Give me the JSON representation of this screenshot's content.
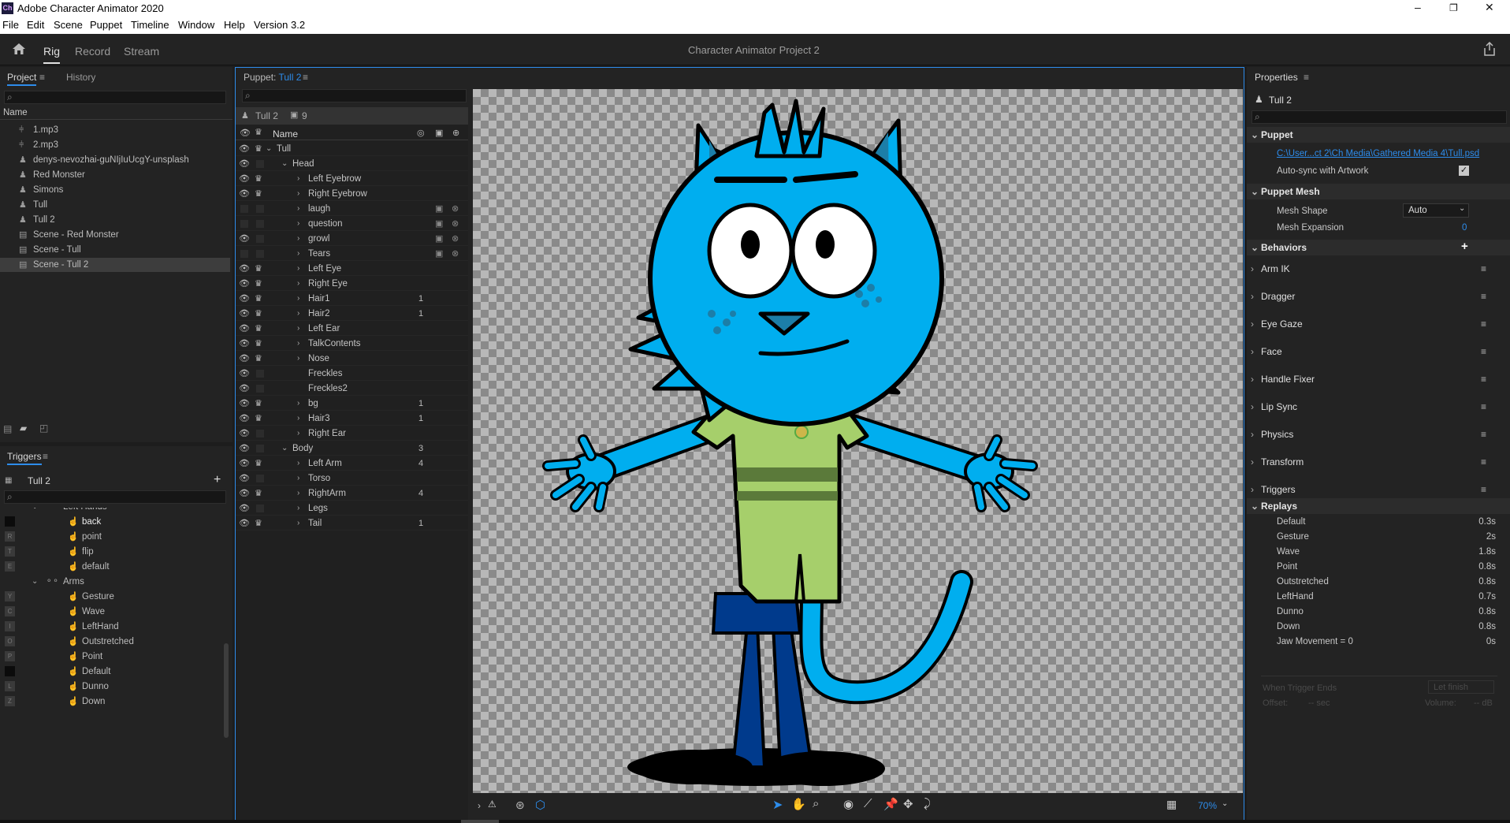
{
  "window": {
    "app_badge": "Ch",
    "title": "Adobe Character Animator 2020",
    "minimize": "–",
    "maximize": "❐",
    "close": "✕"
  },
  "menu": [
    "File",
    "Edit",
    "Scene",
    "Puppet",
    "Timeline",
    "Window",
    "Help",
    "Version 3.2"
  ],
  "header": {
    "tabs": [
      "Rig",
      "Record",
      "Stream"
    ],
    "active_tab": "Rig",
    "project_title": "Character Animator Project 2"
  },
  "project_panel": {
    "tabs": [
      "Project",
      "History"
    ],
    "column_header": "Name",
    "items": [
      {
        "name": "1.mp3",
        "icon": "audio-icon"
      },
      {
        "name": "2.mp3",
        "icon": "audio-icon"
      },
      {
        "name": "denys-nevozhai-guNIjIuUcgY-unsplash",
        "icon": "puppet-icon"
      },
      {
        "name": "Red Monster",
        "icon": "puppet-icon"
      },
      {
        "name": "Simons",
        "icon": "puppet-icon"
      },
      {
        "name": "Tull",
        "icon": "puppet-icon"
      },
      {
        "name": "Tull 2",
        "icon": "puppet-icon"
      },
      {
        "name": "Scene - Red Monster",
        "icon": "scene-icon"
      },
      {
        "name": "Scene - Tull",
        "icon": "scene-icon"
      },
      {
        "name": "Scene - Tull 2",
        "icon": "scene-icon",
        "selected": true
      }
    ]
  },
  "triggers_panel": {
    "title": "Triggers",
    "puppet_name": "Tull 2",
    "add": "+",
    "rows": [
      {
        "label": "Left Hands",
        "kind": "group",
        "key": ""
      },
      {
        "label": "back",
        "kind": "trigger",
        "key": "",
        "keycolor": "black",
        "bright": true
      },
      {
        "label": "point",
        "kind": "trigger",
        "key": "R"
      },
      {
        "label": "flip",
        "kind": "trigger",
        "key": "T"
      },
      {
        "label": "default",
        "kind": "trigger",
        "key": "E"
      },
      {
        "label": "Arms",
        "kind": "group",
        "key": ""
      },
      {
        "label": "Gesture",
        "kind": "trigger",
        "key": "Y"
      },
      {
        "label": "Wave",
        "kind": "trigger",
        "key": "C"
      },
      {
        "label": "LeftHand",
        "kind": "trigger",
        "key": "I"
      },
      {
        "label": "Outstretched",
        "kind": "trigger",
        "key": "O"
      },
      {
        "label": "Point",
        "kind": "trigger",
        "key": "P"
      },
      {
        "label": "Default",
        "kind": "trigger",
        "key": "",
        "keycolor": "black"
      },
      {
        "label": "Dunno",
        "kind": "trigger",
        "key": "L"
      },
      {
        "label": "Down",
        "kind": "trigger",
        "key": "Z"
      }
    ]
  },
  "puppet_panel": {
    "label_prefix": "Puppet:",
    "puppet_name": "Tull 2",
    "crumb": "Tull 2",
    "count": "9",
    "column_name": "Name",
    "layers": [
      {
        "name": "Tull",
        "depth": 0,
        "twisty": "open",
        "eye": true,
        "crown": true,
        "n": ""
      },
      {
        "name": "Head",
        "depth": 1,
        "twisty": "open",
        "eye": true,
        "crown": false,
        "n": ""
      },
      {
        "name": "Left Eyebrow",
        "depth": 2,
        "twisty": "closed",
        "eye": true,
        "crown": true,
        "n": ""
      },
      {
        "name": "Right Eyebrow",
        "depth": 2,
        "twisty": "closed",
        "eye": true,
        "crown": true,
        "n": ""
      },
      {
        "name": "laugh",
        "depth": 2,
        "twisty": "closed",
        "eye": false,
        "crown": false,
        "n": "",
        "trig": true
      },
      {
        "name": "question",
        "depth": 2,
        "twisty": "closed",
        "eye": false,
        "crown": false,
        "n": "",
        "trig": true
      },
      {
        "name": "growl",
        "depth": 2,
        "twisty": "closed",
        "eye": true,
        "crown": false,
        "n": "",
        "trig": true
      },
      {
        "name": "Tears",
        "depth": 2,
        "twisty": "closed",
        "eye": false,
        "crown": false,
        "n": "",
        "trig": true
      },
      {
        "name": "Left Eye",
        "depth": 2,
        "twisty": "closed",
        "eye": true,
        "crown": true,
        "n": ""
      },
      {
        "name": "Right Eye",
        "depth": 2,
        "twisty": "closed",
        "eye": true,
        "crown": true,
        "n": ""
      },
      {
        "name": "Hair1",
        "depth": 2,
        "twisty": "closed",
        "eye": true,
        "crown": true,
        "n": "1"
      },
      {
        "name": "Hair2",
        "depth": 2,
        "twisty": "closed",
        "eye": true,
        "crown": true,
        "n": "1"
      },
      {
        "name": "Left Ear",
        "depth": 2,
        "twisty": "closed",
        "eye": true,
        "crown": true,
        "n": ""
      },
      {
        "name": "TalkContents",
        "depth": 2,
        "twisty": "closed",
        "eye": true,
        "crown": true,
        "n": ""
      },
      {
        "name": "Nose",
        "depth": 2,
        "twisty": "closed",
        "eye": true,
        "crown": true,
        "n": ""
      },
      {
        "name": "Freckles",
        "depth": 2,
        "twisty": "none",
        "eye": true,
        "crown": false,
        "n": ""
      },
      {
        "name": "Freckles2",
        "depth": 2,
        "twisty": "none",
        "eye": true,
        "crown": false,
        "n": ""
      },
      {
        "name": "bg",
        "depth": 2,
        "twisty": "closed",
        "eye": true,
        "crown": true,
        "n": "1"
      },
      {
        "name": "Hair3",
        "depth": 2,
        "twisty": "closed",
        "eye": true,
        "crown": true,
        "n": "1"
      },
      {
        "name": "Right Ear",
        "depth": 2,
        "twisty": "closed",
        "eye": true,
        "crown": false,
        "n": ""
      },
      {
        "name": "Body",
        "depth": 1,
        "twisty": "open",
        "eye": true,
        "crown": false,
        "n": "3"
      },
      {
        "name": "Left Arm",
        "depth": 2,
        "twisty": "closed",
        "eye": true,
        "crown": true,
        "n": "4"
      },
      {
        "name": "Torso",
        "depth": 2,
        "twisty": "closed",
        "eye": true,
        "crown": false,
        "n": ""
      },
      {
        "name": "RightArm",
        "depth": 2,
        "twisty": "closed",
        "eye": true,
        "crown": true,
        "n": "4"
      },
      {
        "name": "Legs",
        "depth": 2,
        "twisty": "closed",
        "eye": true,
        "crown": false,
        "n": ""
      },
      {
        "name": "Tail",
        "depth": 2,
        "twisty": "closed",
        "eye": true,
        "crown": true,
        "n": "1"
      }
    ],
    "zoom": "70%"
  },
  "properties": {
    "title": "Properties",
    "puppet_name": "Tull 2",
    "puppet_section": "Puppet",
    "file_path": "C:\\User...ct 2\\Ch Media\\Gathered Media 4\\Tull.psd",
    "autosync_label": "Auto-sync with Artwork",
    "mesh_section": "Puppet Mesh",
    "mesh_shape_label": "Mesh Shape",
    "mesh_shape_value": "Auto",
    "mesh_expansion_label": "Mesh Expansion",
    "mesh_expansion_value": "0",
    "behaviors_section": "Behaviors",
    "behaviors": [
      "Arm IK",
      "Dragger",
      "Eye Gaze",
      "Face",
      "Handle Fixer",
      "Lip Sync",
      "Physics",
      "Transform",
      "Triggers"
    ],
    "replays_section": "Replays",
    "replays": [
      {
        "name": "Default",
        "dur": "0.3s"
      },
      {
        "name": "Gesture",
        "dur": "2s"
      },
      {
        "name": "Wave",
        "dur": "1.8s"
      },
      {
        "name": "Point",
        "dur": "0.8s"
      },
      {
        "name": "Outstretched",
        "dur": "0.8s"
      },
      {
        "name": "LeftHand",
        "dur": "0.7s"
      },
      {
        "name": "Dunno",
        "dur": "0.8s"
      },
      {
        "name": "Down",
        "dur": "0.8s"
      },
      {
        "name": "Jaw Movement = 0",
        "dur": "0s"
      }
    ],
    "when_trigger_ends_label": "When Trigger Ends",
    "when_trigger_ends_value": "Let finish",
    "offset_label": "Offset:",
    "offset_value": "-- sec",
    "volume_label": "Volume:",
    "volume_value": "-- dB"
  },
  "colors": {
    "accent": "#2d8ceb",
    "panel_bg": "#232323",
    "cat_blue": "#00aeef",
    "shirt_green": "#a6cf6b",
    "pants_blue": "#003a8c"
  }
}
